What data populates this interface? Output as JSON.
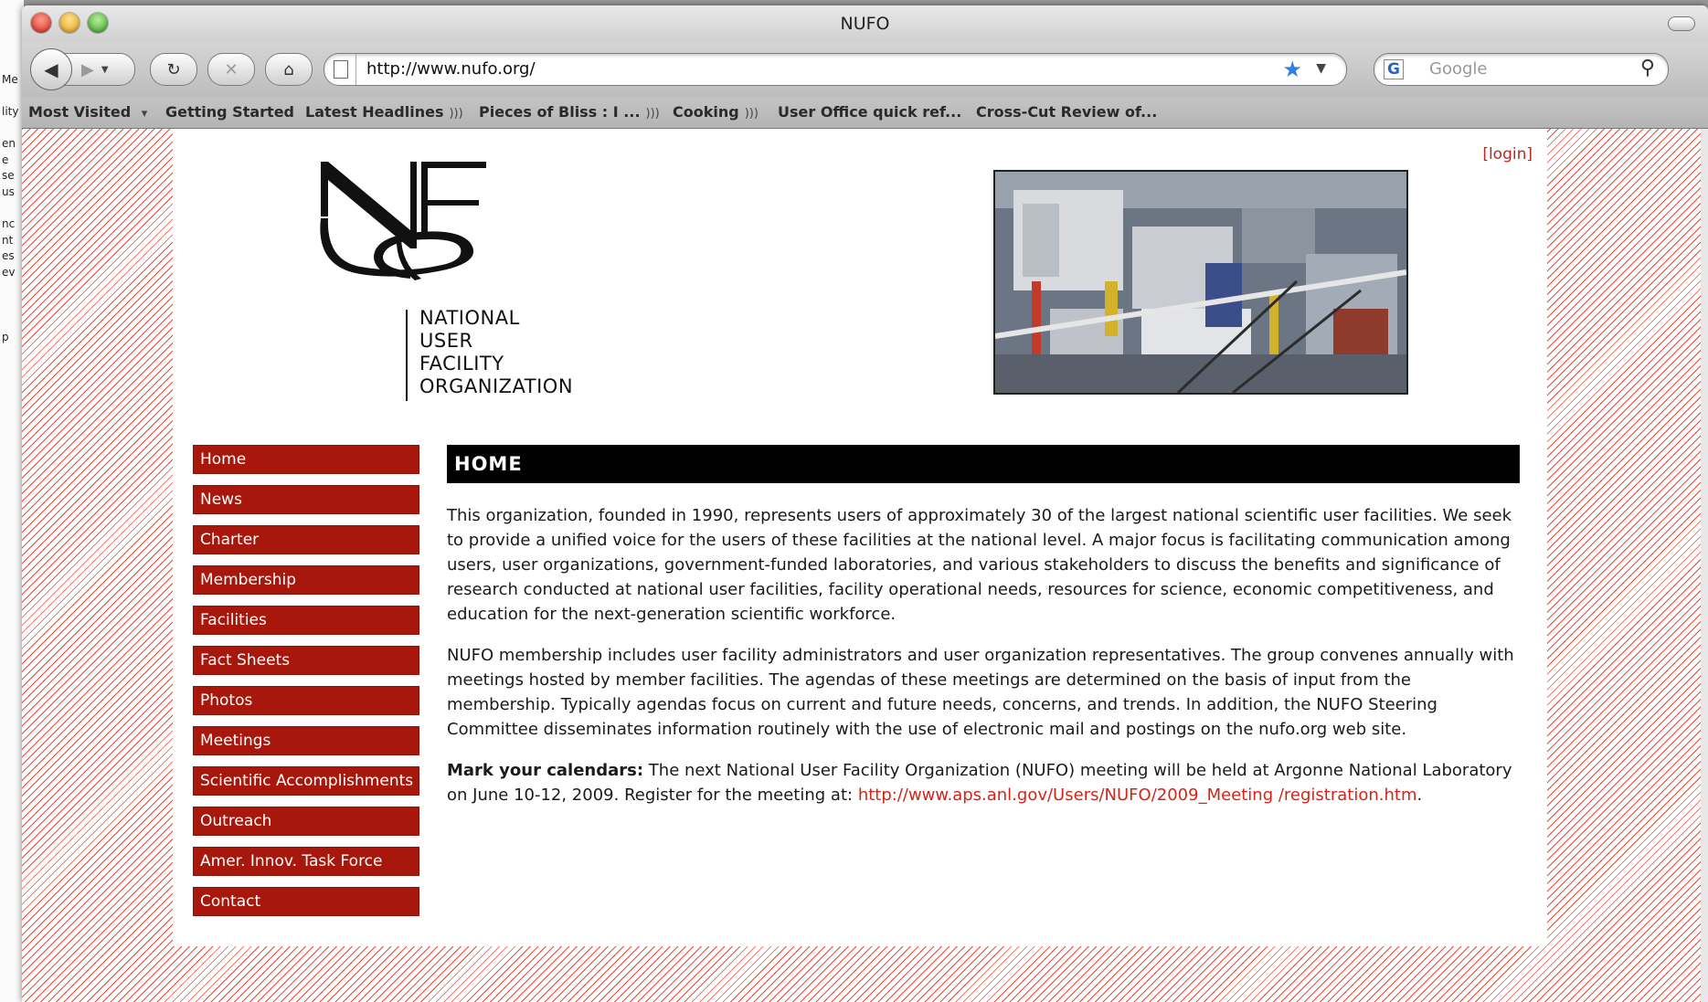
{
  "window": {
    "title": "NUFO"
  },
  "toolbar": {
    "url": "http://www.nufo.org/",
    "search_placeholder": "Google"
  },
  "bookmarks": {
    "most_visited": "Most Visited",
    "getting_started": "Getting Started",
    "latest_headlines": "Latest Headlines",
    "pieces_of_bliss": "Pieces of Bliss : I ...",
    "cooking": "Cooking",
    "user_office": "User Office quick ref...",
    "cross_cut": "Cross-Cut Review of..."
  },
  "page": {
    "login": "[login]",
    "logo_lines": [
      "NATIONAL",
      "USER",
      "FACILITY",
      "ORGANIZATION"
    ],
    "nav": [
      "Home",
      "News",
      "Charter",
      "Membership",
      "Facilities",
      "Fact Sheets",
      "Photos",
      "Meetings",
      "Scientific Accomplishments",
      "Outreach",
      "Amer. Innov. Task Force",
      "Contact"
    ],
    "heading": "HOME",
    "para1": "This organization, founded in 1990, represents users of approximately 30 of the largest national scientific user facilities. We seek to provide a unified voice for the users of these facilities at the national level. A major focus is facilitating communication among users, user organizations, government-funded laboratories, and various stakeholders to discuss the benefits and significance of research conducted at national user facilities, facility operational needs, resources for science, economic competitiveness, and education for the next-generation scientific workforce.",
    "para2": "NUFO membership includes user facility administrators and user organization representatives. The group convenes annually with meetings hosted by member facilities. The agendas of these meetings are determined on the basis of input from the membership. Typically agendas focus on current and future needs, concerns, and trends. In addition, the NUFO Steering Committee disseminates information routinely with the use of electronic mail and postings on the nufo.org web site.",
    "para3_bold": "Mark your calendars:",
    "para3_text": " The next National User Facility Organization (NUFO) meeting will be held at Argonne National Laboratory on June 10-12, 2009. Register for the meeting at: ",
    "para3_link": "http://www.aps.anl.gov/Users/NUFO/2009_Meeting /registration.htm",
    "para3_end": "."
  },
  "colors": {
    "nav_bg": "#a8170c",
    "link": "#d42418",
    "stripe": "#e84a3c"
  }
}
